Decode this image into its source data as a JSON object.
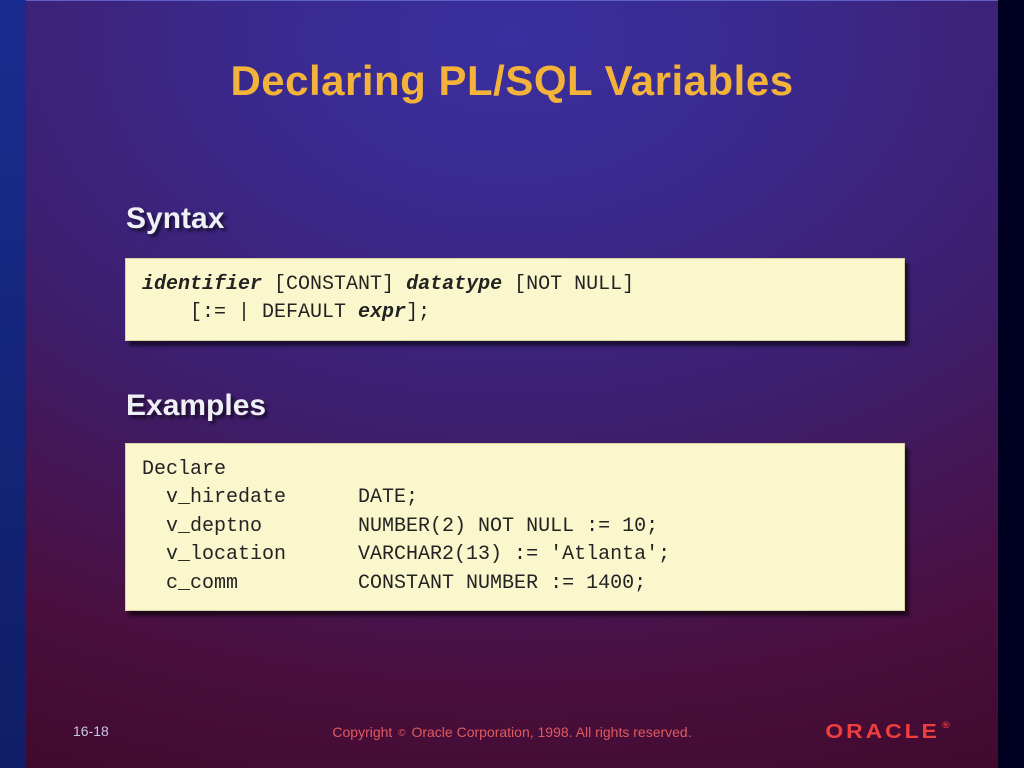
{
  "title": "Declaring PL/SQL Variables",
  "sections": {
    "syntax": {
      "heading": "Syntax",
      "lines": {
        "l1a": "identifier",
        "l1b": " [CONSTANT] ",
        "l1c": "datatype",
        "l1d": " [NOT NULL]",
        "l2a": "    [:= | DEFAULT ",
        "l2b": "expr",
        "l2c": "];"
      }
    },
    "examples": {
      "heading": "Examples",
      "lines": {
        "d0": "Declare",
        "d1": "  v_hiredate      DATE;",
        "d2": "  v_deptno        NUMBER(2) NOT NULL := 10;",
        "d3": "  v_location      VARCHAR2(13) := 'Atlanta';",
        "d4": "  c_comm          CONSTANT NUMBER := 1400;"
      }
    }
  },
  "footer": {
    "slide": "16-18",
    "copyright_prefix": "Copyright ",
    "copyright_symbol": "©",
    "copyright_suffix": " Oracle Corporation, 1998. All rights reserved.",
    "logo": "ORACLE",
    "logo_mark": "®"
  }
}
